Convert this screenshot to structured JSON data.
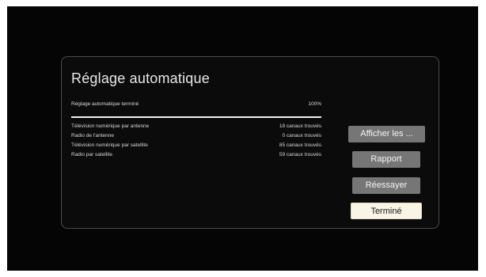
{
  "dialog": {
    "title": "Réglage automatique",
    "status_label": "Réglage automatique terminé",
    "status_percent": "100%",
    "progress": 1.0,
    "results": [
      {
        "label": "Télévision numérique par antenne",
        "value": "18 canaux trouvés"
      },
      {
        "label": "Radio de l'antenne",
        "value": "0 canaux trouvés"
      },
      {
        "label": "Télévision numérique par satellite",
        "value": "85 canaux trouvés"
      },
      {
        "label": "Radio par satellite",
        "value": "59 canaux trouvés"
      }
    ]
  },
  "buttons": {
    "show_label": "Afficher les ...",
    "report_label": "Rapport",
    "retry_label": "Réessayer",
    "done_label": "Terminé"
  },
  "colors": {
    "screen_background": "#050505",
    "button_gray": "#767676",
    "button_focused": "#f8f4e6"
  }
}
